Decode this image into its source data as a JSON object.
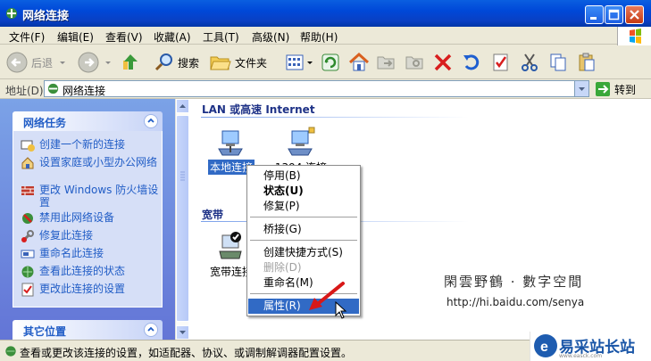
{
  "window": {
    "title": "网络连接"
  },
  "menu": [
    "文件(F)",
    "编辑(E)",
    "查看(V)",
    "收藏(A)",
    "工具(T)",
    "高级(N)",
    "帮助(H)"
  ],
  "toolbar": {
    "back": "后退",
    "search": "搜索",
    "folders": "文件夹"
  },
  "address": {
    "label": "地址(D)",
    "value": "网络连接",
    "go": "转到"
  },
  "sidebar": {
    "network_tasks_title": "网络任务",
    "items": [
      {
        "label": "创建一个新的连接",
        "icon": "new-connection-icon"
      },
      {
        "label": "设置家庭或小型办公网络",
        "icon": "home-network-icon"
      },
      {
        "label": "更改 Windows 防火墙设置",
        "icon": "firewall-icon"
      },
      {
        "label": "禁用此网络设备",
        "icon": "disable-device-icon"
      },
      {
        "label": "修复此连接",
        "icon": "repair-icon"
      },
      {
        "label": "重命名此连接",
        "icon": "rename-icon"
      },
      {
        "label": "查看此连接的状态",
        "icon": "status-icon"
      },
      {
        "label": "更改此连接的设置",
        "icon": "settings-icon"
      }
    ],
    "other_places_title": "其它位置"
  },
  "main": {
    "groups": [
      {
        "title": "LAN 或高速 Internet"
      },
      {
        "title": "宽带"
      }
    ],
    "connections": [
      {
        "label": "本地连接"
      },
      {
        "label": "1394 连接"
      },
      {
        "label": "宽带连接"
      }
    ]
  },
  "context_menu": [
    {
      "label": "停用(B)"
    },
    {
      "label": "状态(U)"
    },
    {
      "label": "修复(P)"
    },
    {
      "label": "桥接(G)"
    },
    {
      "label": "创建快捷方式(S)"
    },
    {
      "label": "删除(D)"
    },
    {
      "label": "重命名(M)"
    },
    {
      "label": "属性(R)"
    }
  ],
  "watermark": {
    "text": "閑雲野鶴 · 數字空間",
    "url": "http://hi.baidu.com/senya"
  },
  "status": {
    "text": "查看或更改该连接的设置，如适配器、协议、或调制解调器配置设置。"
  },
  "brand": {
    "name": "易采站长站",
    "url": "www.easck.com"
  }
}
